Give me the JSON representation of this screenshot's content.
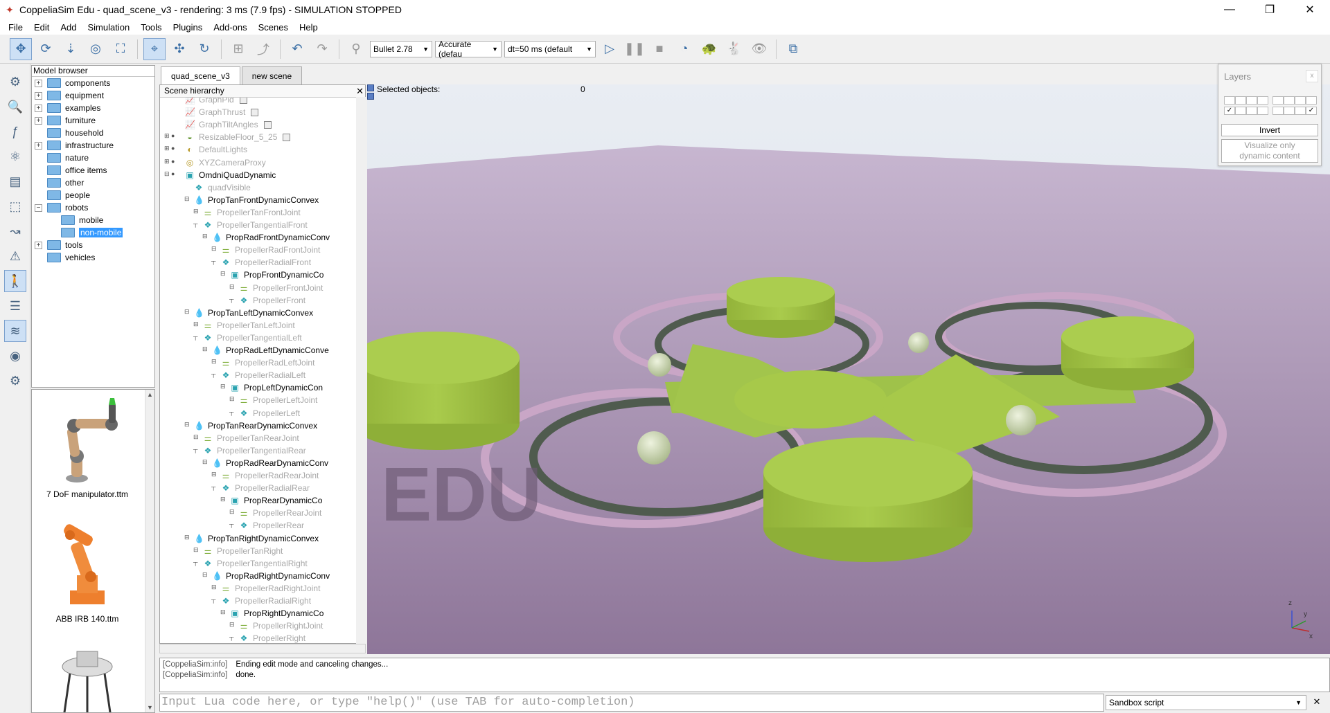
{
  "window": {
    "title": "CoppeliaSim Edu - quad_scene_v3 - rendering: 3 ms (7.9 fps) - SIMULATION STOPPED",
    "minimize": "—",
    "restore": "❐",
    "close": "✕"
  },
  "menu": [
    "File",
    "Edit",
    "Add",
    "Simulation",
    "Tools",
    "Plugins",
    "Add-ons",
    "Scenes",
    "Help"
  ],
  "toolbar": {
    "engine": "Bullet 2.78",
    "accuracy": "Accurate (defau",
    "timestep": "dt=50 ms (default"
  },
  "model_browser": {
    "title": "Model browser",
    "items": [
      {
        "label": "components",
        "expandable": true
      },
      {
        "label": "equipment",
        "expandable": true
      },
      {
        "label": "examples",
        "expandable": true
      },
      {
        "label": "furniture",
        "expandable": true
      },
      {
        "label": "household",
        "expandable": false
      },
      {
        "label": "infrastructure",
        "expandable": true
      },
      {
        "label": "nature",
        "expandable": false
      },
      {
        "label": "office items",
        "expandable": false
      },
      {
        "label": "other",
        "expandable": false
      },
      {
        "label": "people",
        "expandable": false
      },
      {
        "label": "robots",
        "expandable": true,
        "expanded": true
      },
      {
        "label": "mobile",
        "child": true
      },
      {
        "label": "non-mobile",
        "child": true,
        "selected": true
      },
      {
        "label": "tools",
        "expandable": true
      },
      {
        "label": "vehicles",
        "expandable": false
      }
    ]
  },
  "model_thumbs": [
    {
      "caption": "7 DoF manipulator.ttm"
    },
    {
      "caption": "ABB IRB 140.ttm"
    }
  ],
  "tabs": [
    "quad_scene_v3",
    "new scene"
  ],
  "scene_hierarchy": {
    "title": "Scene hierarchy",
    "rows": [
      {
        "label": "GraphPid",
        "dim": true,
        "icon": "graph"
      },
      {
        "label": "GraphThrust",
        "dim": true,
        "icon": "graph"
      },
      {
        "label": "GraphTiltAngles",
        "dim": true,
        "icon": "graph"
      },
      {
        "label": "ResizableFloor_5_25",
        "dim": true,
        "icon": "shape"
      },
      {
        "label": "DefaultLights",
        "dim": true,
        "icon": "light"
      },
      {
        "label": "XYZCameraProxy",
        "dim": true,
        "icon": "camera"
      },
      {
        "label": "OmdniQuadDynamic",
        "dim": false,
        "icon": "cube"
      },
      {
        "label": "quadVisible",
        "dim": true,
        "icon": "shapes"
      },
      {
        "label": "PropTanFrontDynamicConvex",
        "dim": false,
        "icon": "drop"
      },
      {
        "label": "PropellerTanFrontJoint",
        "dim": true,
        "icon": "joint"
      },
      {
        "label": "PropellerTangentialFront",
        "dim": true,
        "icon": "shapes"
      },
      {
        "label": "PropRadFrontDynamicConv",
        "dim": false,
        "icon": "drop"
      },
      {
        "label": "PropellerRadFrontJoint",
        "dim": true,
        "icon": "joint"
      },
      {
        "label": "PropellerRadialFront",
        "dim": true,
        "icon": "shapes"
      },
      {
        "label": "PropFrontDynamicCo",
        "dim": false,
        "icon": "cube"
      },
      {
        "label": "PropellerFrontJoint",
        "dim": true,
        "icon": "joint"
      },
      {
        "label": "PropellerFront",
        "dim": true,
        "icon": "shapes"
      },
      {
        "label": "PropTanLeftDynamicConvex",
        "dim": false,
        "icon": "drop"
      },
      {
        "label": "PropellerTanLeftJoint",
        "dim": true,
        "icon": "joint"
      },
      {
        "label": "PropellerTangentialLeft",
        "dim": true,
        "icon": "shapes"
      },
      {
        "label": "PropRadLeftDynamicConve",
        "dim": false,
        "icon": "drop"
      },
      {
        "label": "PropellerRadLeftJoint",
        "dim": true,
        "icon": "joint"
      },
      {
        "label": "PropellerRadialLeft",
        "dim": true,
        "icon": "shapes"
      },
      {
        "label": "PropLeftDynamicCon",
        "dim": false,
        "icon": "cube"
      },
      {
        "label": "PropellerLeftJoint",
        "dim": true,
        "icon": "joint"
      },
      {
        "label": "PropellerLeft",
        "dim": true,
        "icon": "shapes"
      },
      {
        "label": "PropTanRearDynamicConvex",
        "dim": false,
        "icon": "drop"
      },
      {
        "label": "PropellerTanRearJoint",
        "dim": true,
        "icon": "joint"
      },
      {
        "label": "PropellerTangentialRear",
        "dim": true,
        "icon": "shapes"
      },
      {
        "label": "PropRadRearDynamicConv",
        "dim": false,
        "icon": "drop"
      },
      {
        "label": "PropellerRadRearJoint",
        "dim": true,
        "icon": "joint"
      },
      {
        "label": "PropellerRadialRear",
        "dim": true,
        "icon": "shapes"
      },
      {
        "label": "PropRearDynamicCo",
        "dim": false,
        "icon": "cube"
      },
      {
        "label": "PropellerRearJoint",
        "dim": true,
        "icon": "joint"
      },
      {
        "label": "PropellerRear",
        "dim": true,
        "icon": "shapes"
      },
      {
        "label": "PropTanRightDynamicConvex",
        "dim": false,
        "icon": "drop"
      },
      {
        "label": "PropellerTanRight",
        "dim": true,
        "icon": "joint"
      },
      {
        "label": "PropellerTangentialRight",
        "dim": true,
        "icon": "shapes"
      },
      {
        "label": "PropRadRightDynamicConv",
        "dim": false,
        "icon": "drop"
      },
      {
        "label": "PropellerRadRightJoint",
        "dim": true,
        "icon": "joint"
      },
      {
        "label": "PropellerRadialRight",
        "dim": true,
        "icon": "shapes"
      },
      {
        "label": "PropRightDynamicCo",
        "dim": false,
        "icon": "cube"
      },
      {
        "label": "PropellerRightJoint",
        "dim": true,
        "icon": "joint"
      },
      {
        "label": "PropellerRight",
        "dim": true,
        "icon": "shapes"
      }
    ]
  },
  "viewport": {
    "selected_label": "Selected objects:",
    "selected_count": "0",
    "watermark": "EDU",
    "axis_z": "z",
    "axis_x": "x",
    "axis_y": "y",
    "floor_color": "#a58aaa",
    "model_color": "#a7c94a"
  },
  "layers": {
    "title": "Layers",
    "close": "x",
    "check": "✓",
    "invert": "Invert",
    "visualize": "Visualize only dynamic content"
  },
  "log": [
    {
      "prefix": "[CoppeliaSim:info]",
      "text": "Ending edit mode and canceling changes..."
    },
    {
      "prefix": "[CoppeliaSim:info]",
      "text": "done."
    }
  ],
  "command": {
    "placeholder": "Input Lua code here, or type \"help()\" (use TAB for auto-completion)",
    "script_type": "Sandbox script",
    "close": "✕"
  }
}
